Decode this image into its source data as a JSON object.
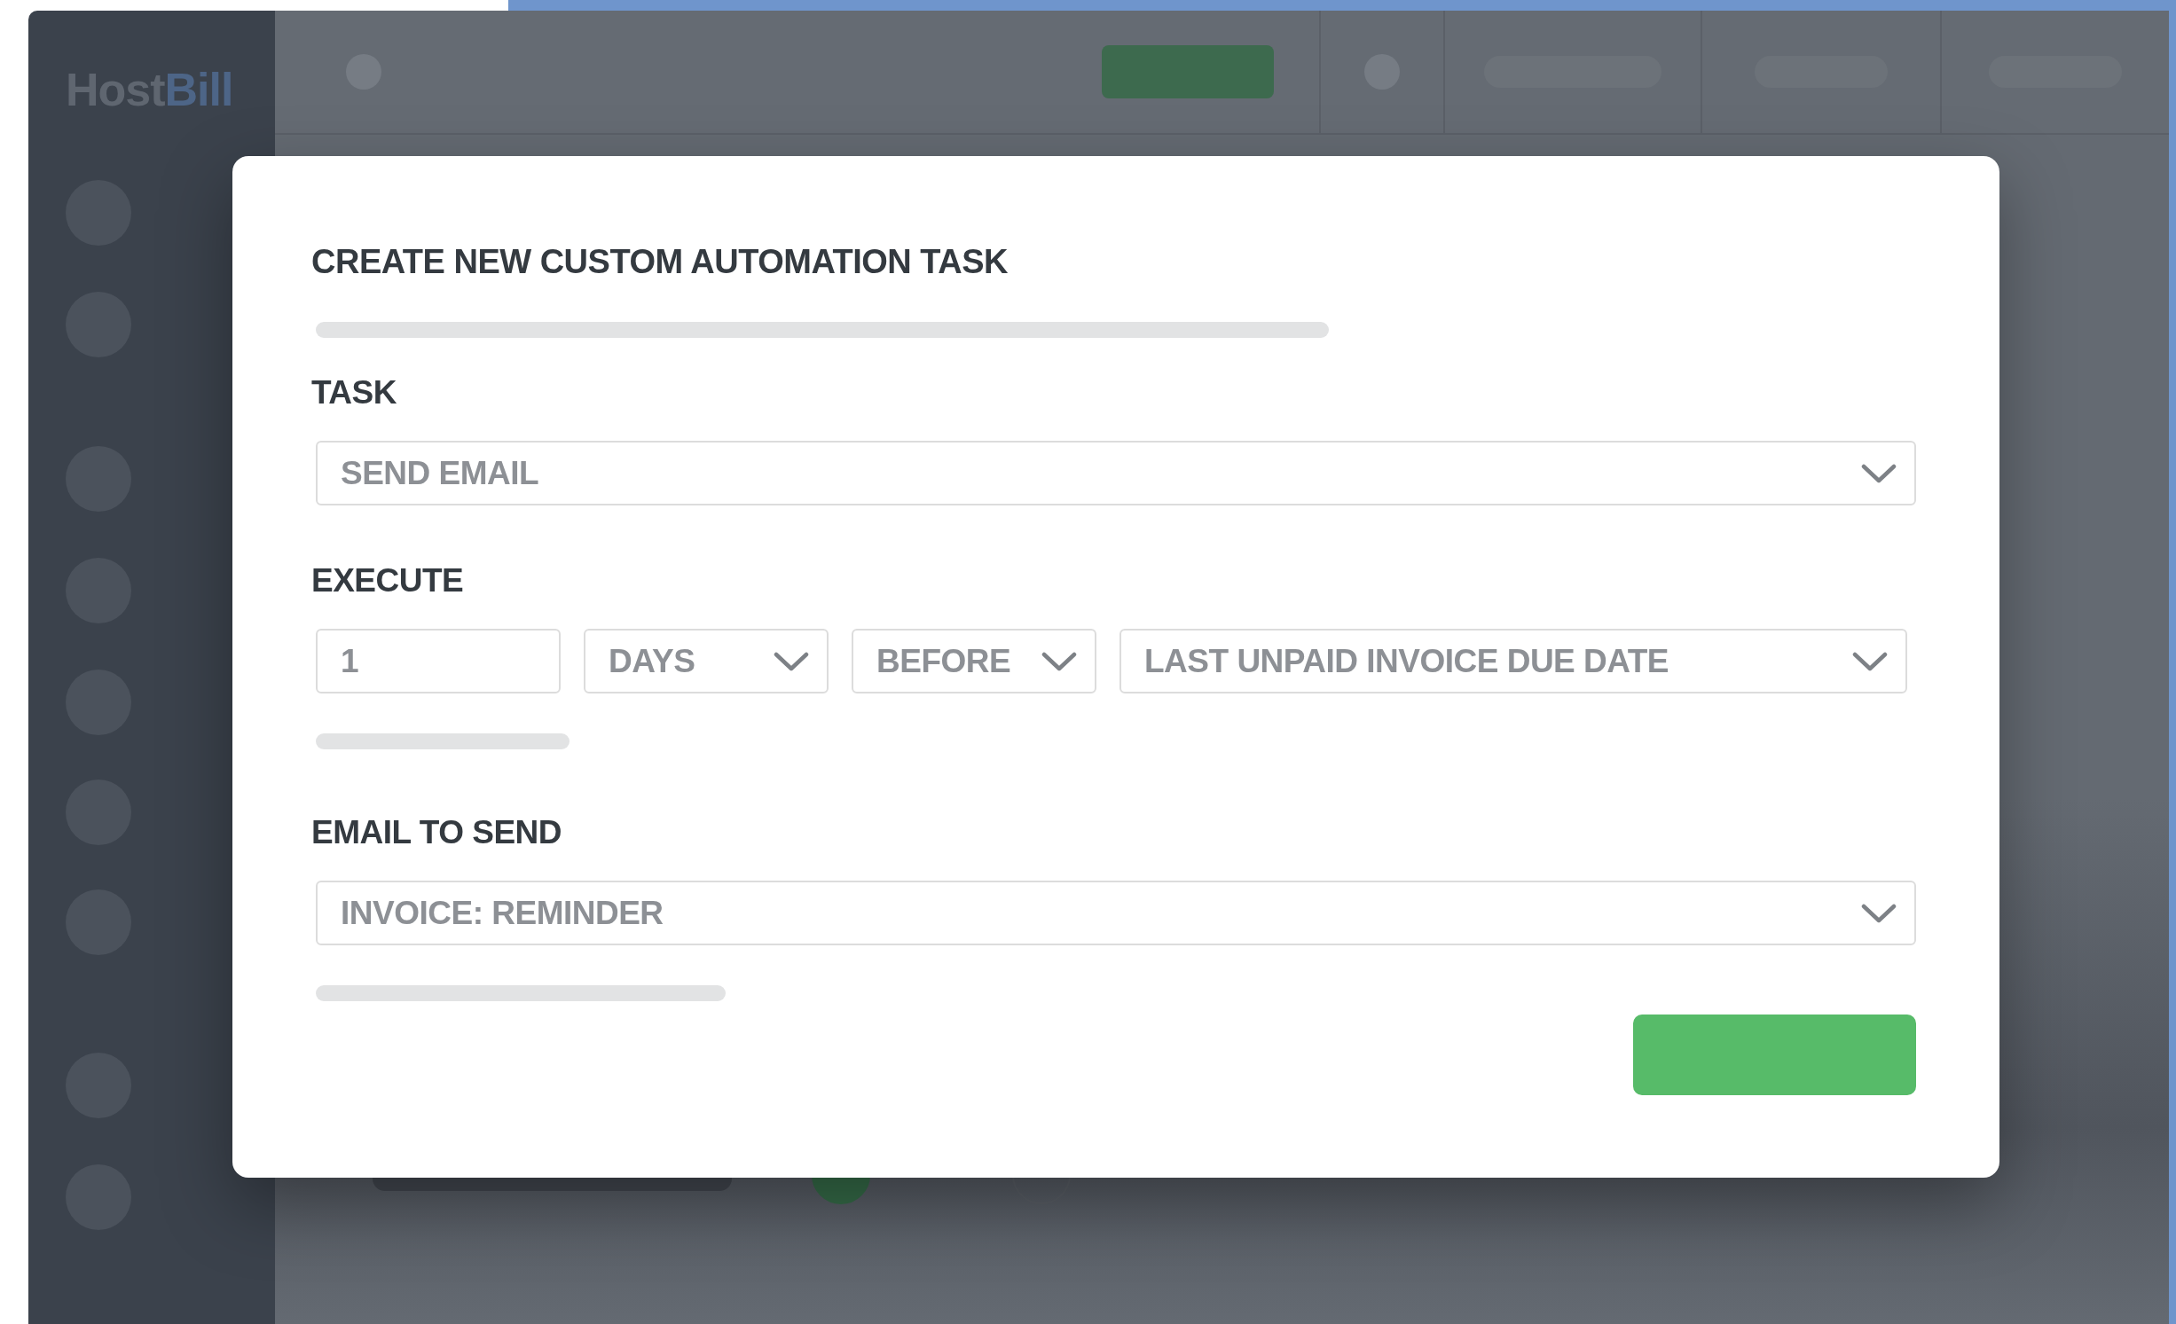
{
  "app": {
    "logo": [
      {
        "text": "Host",
        "accent": false
      },
      {
        "text": "Bill",
        "accent": true
      }
    ]
  },
  "background_radios": [
    {
      "selected": true
    },
    {
      "selected": false
    }
  ],
  "modal": {
    "title": "CREATE NEW CUSTOM AUTOMATION TASK",
    "sections": [
      {
        "label": "TASK",
        "controls": [
          {
            "kind": "select",
            "value": "SEND EMAIL"
          }
        ]
      },
      {
        "label": "EXECUTE",
        "controls": [
          {
            "kind": "input",
            "value": "1"
          },
          {
            "kind": "select",
            "value": "DAYS"
          },
          {
            "kind": "select",
            "value": "BEFORE"
          },
          {
            "kind": "select",
            "value": "LAST UNPAID INVOICE DUE DATE"
          }
        ]
      },
      {
        "label": "EMAIL TO SEND",
        "controls": [
          {
            "kind": "select",
            "value": "INVOICE: REMINDER"
          }
        ]
      }
    ]
  }
}
